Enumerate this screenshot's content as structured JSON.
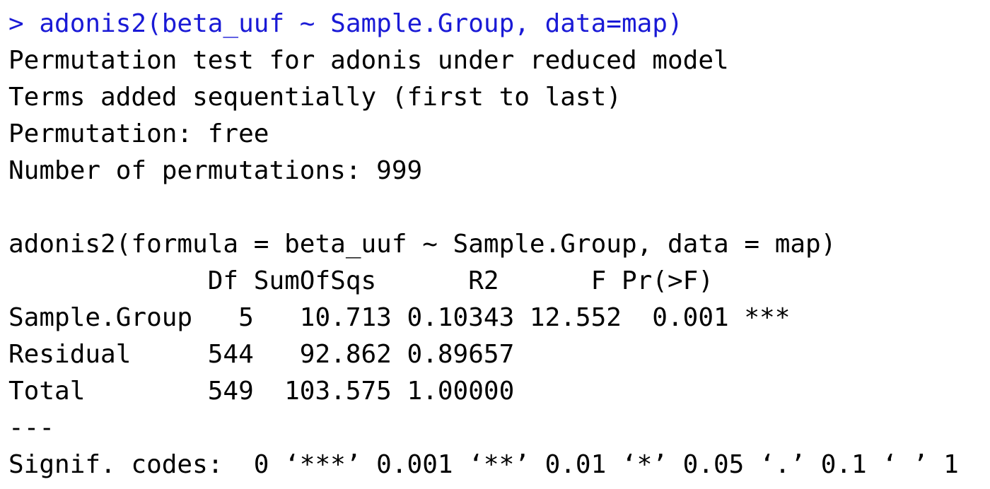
{
  "console": {
    "command": "> adonis2(beta_uuf ~ Sample.Group, data=map)",
    "header_lines": [
      "Permutation test for adonis under reduced model",
      "Terms added sequentially (first to last)",
      "Permutation: free",
      "Number of permutations: 999"
    ],
    "blank": "",
    "formula_line": "adonis2(formula = beta_uuf ~ Sample.Group, data = map)",
    "table": {
      "header": "             Df SumOfSqs      R2      F Pr(>F)    ",
      "rows": [
        "Sample.Group   5   10.713 0.10343 12.552  0.001 ***",
        "Residual     544   92.862 0.89657                  ",
        "Total        549  103.575 1.00000                  "
      ]
    },
    "separator": "---",
    "signif_codes": "Signif. codes:  0 ‘***’ 0.001 ‘**’ 0.01 ‘*’ 0.05 ‘.’ 0.1 ‘ ’ 1"
  },
  "colors": {
    "command": "#1a1ad6",
    "output": "#000000",
    "background": "#ffffff"
  }
}
